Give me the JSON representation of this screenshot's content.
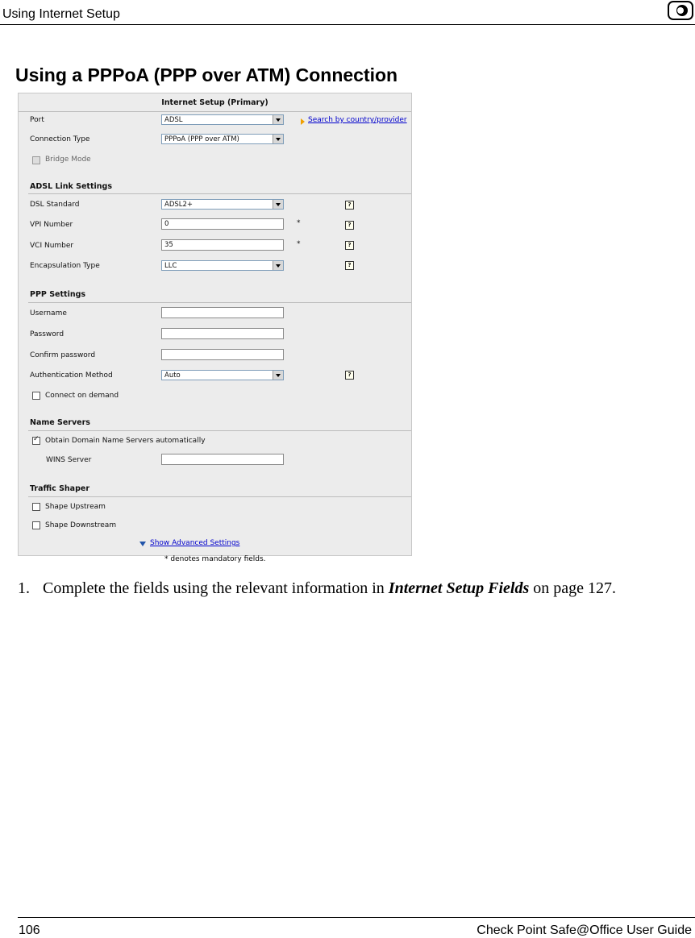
{
  "header": {
    "title": "Using Internet Setup",
    "logo_icon": "check-point-logo-icon"
  },
  "heading": "Using a PPPoA (PPP over ATM) Connection",
  "panel": {
    "title": "Internet Setup (Primary)",
    "port": {
      "label": "Port",
      "value": "ADSL",
      "link": "Search by country/provider"
    },
    "connection_type": {
      "label": "Connection Type",
      "value": "PPPoA (PPP over ATM)"
    },
    "bridge_mode": {
      "label": "Bridge Mode",
      "checked": false,
      "disabled": true
    },
    "adsl": {
      "section": "ADSL Link Settings",
      "dsl_standard": {
        "label": "DSL Standard",
        "value": "ADSL2+"
      },
      "vpi": {
        "label": "VPI Number",
        "value": "0",
        "mandatory": "*"
      },
      "vci": {
        "label": "VCI Number",
        "value": "35",
        "mandatory": "*"
      },
      "encapsulation": {
        "label": "Encapsulation Type",
        "value": "LLC"
      }
    },
    "ppp": {
      "section": "PPP Settings",
      "username": {
        "label": "Username",
        "value": ""
      },
      "password": {
        "label": "Password",
        "value": ""
      },
      "confirm": {
        "label": "Confirm password",
        "value": ""
      },
      "auth": {
        "label": "Authentication Method",
        "value": "Auto"
      },
      "connect_on_demand": {
        "label": "Connect on demand",
        "checked": false
      }
    },
    "name_servers": {
      "section": "Name Servers",
      "obtain_auto": {
        "label": "Obtain Domain Name Servers automatically",
        "checked": true
      },
      "wins": {
        "label": "WINS Server",
        "value": ""
      }
    },
    "traffic_shaper": {
      "section": "Traffic Shaper",
      "upstream": {
        "label": "Shape Upstream",
        "checked": false
      },
      "downstream": {
        "label": "Shape Downstream",
        "checked": false
      }
    },
    "advanced_link": "Show Advanced Settings",
    "help_glyph": "?",
    "footnote": "* denotes mandatory fields."
  },
  "step": {
    "number": "1.",
    "text_before": "Complete the fields using the relevant information in ",
    "emphasis": "Internet Setup Fields",
    "text_after": " on page 127."
  },
  "footer": {
    "page": "106",
    "title": "Check Point Safe@Office User Guide"
  },
  "colors": {
    "link": "#0000cc",
    "panel_bg": "#ececec",
    "arrow_accent": "#f0a000"
  }
}
